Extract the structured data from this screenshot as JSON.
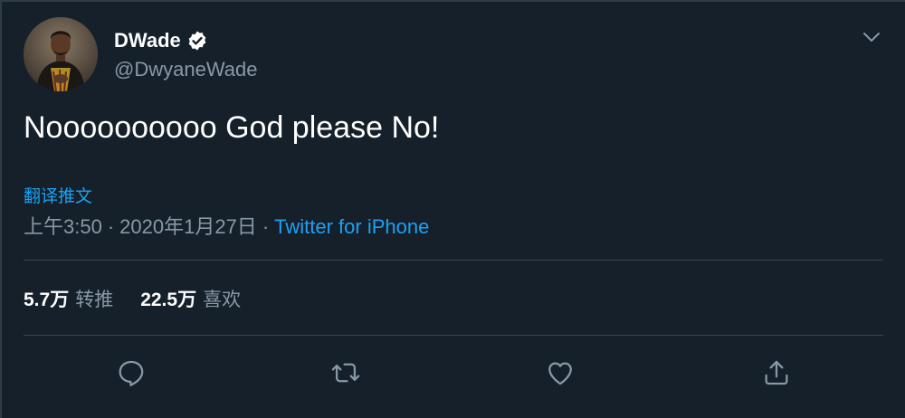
{
  "user": {
    "display_name": "DWade",
    "handle": "@DwyaneWade",
    "verified": true,
    "verified_icon": "verified-badge-icon",
    "avatar_icon": "avatar"
  },
  "tweet": {
    "text": "Noooooooooo God please No!",
    "translate_label": "翻译推文",
    "time": "上午3:50",
    "date": "2020年1月27日",
    "separator": "·",
    "source": "Twitter for iPhone"
  },
  "stats": {
    "retweets_count": "5.7万",
    "retweets_label": "转推",
    "likes_count": "22.5万",
    "likes_label": "喜欢"
  },
  "actions": [
    "reply-icon",
    "retweet-icon",
    "like-icon",
    "share-icon"
  ],
  "colors": {
    "background": "#15202b",
    "accent": "#1da1f2",
    "secondary_text": "#8899a6",
    "divider": "#38444d"
  }
}
